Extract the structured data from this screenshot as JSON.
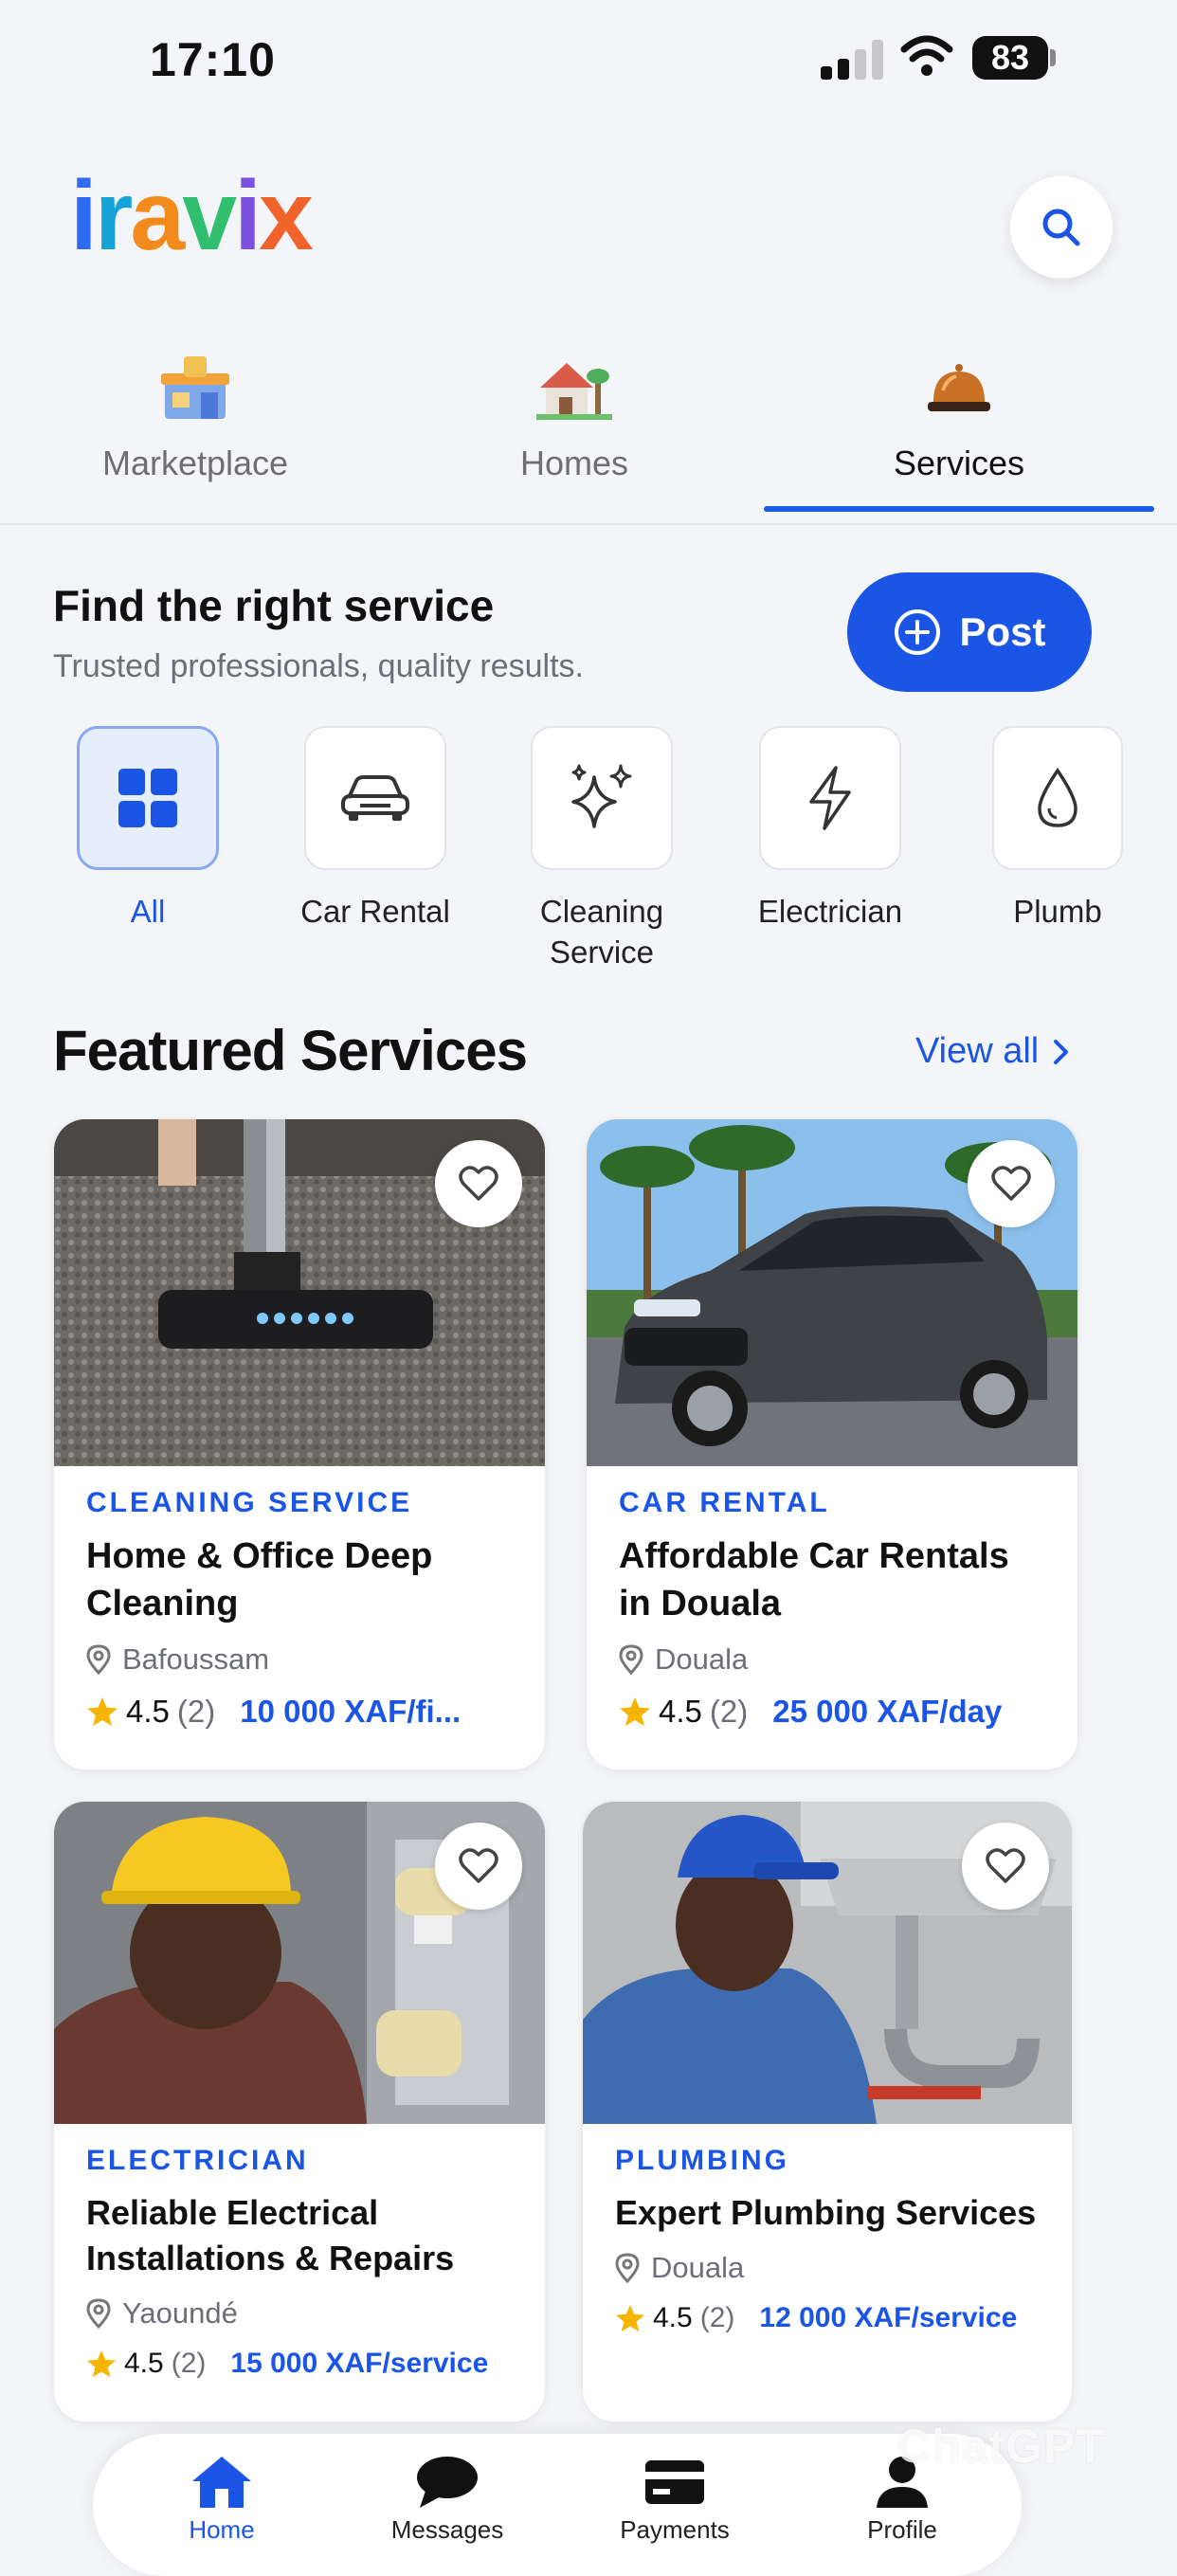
{
  "status_bar": {
    "time": "17:10",
    "battery": "83"
  },
  "header": {
    "logo_parts": [
      "i",
      "r",
      "a",
      "v",
      "i",
      "x"
    ]
  },
  "top_tabs": [
    {
      "label": "Marketplace",
      "icon": "marketplace-icon"
    },
    {
      "label": "Homes",
      "icon": "house-icon"
    },
    {
      "label": "Services",
      "icon": "service-bell-icon",
      "active": true
    }
  ],
  "services_header": {
    "title": "Find the right service",
    "subtitle": "Trusted professionals, quality results.",
    "post_label": "Post"
  },
  "categories": [
    {
      "label": "All",
      "icon": "grid-icon",
      "active": true
    },
    {
      "label": "Car Rental",
      "icon": "car-icon"
    },
    {
      "label": "Cleaning Service",
      "icon": "sparkles-icon"
    },
    {
      "label": "Electrician",
      "icon": "lightning-icon"
    },
    {
      "label": "Plumb",
      "icon": "drop-icon"
    }
  ],
  "featured": {
    "title": "Featured Services",
    "view_all": "View all",
    "cards": [
      {
        "category": "CLEANING SERVICE",
        "title": "Home & Office Deep Cleaning",
        "location": "Bafoussam",
        "rating": "4.5",
        "count": "(2)",
        "price": "10 000 XAF/fi..."
      },
      {
        "category": "CAR RENTAL",
        "title": "Affordable Car Rentals in Douala",
        "location": "Douala",
        "rating": "4.5",
        "count": "(2)",
        "price": "25 000 XAF/day"
      },
      {
        "category": "ELECTRICIAN",
        "title": "Reliable Electrical Installations & Repairs",
        "location": "Yaoundé",
        "rating": "4.5",
        "count": "(2)",
        "price": "15 000 XAF/service"
      },
      {
        "category": "PLUMBING",
        "title": "Expert Plumbing Services",
        "location": "Douala",
        "rating": "4.5",
        "count": "(2)",
        "price": "12 000 XAF/service"
      }
    ]
  },
  "bottom_nav": [
    {
      "label": "Home",
      "icon": "home-icon",
      "active": true
    },
    {
      "label": "Messages",
      "icon": "chat-bubble-icon"
    },
    {
      "label": "Payments",
      "icon": "card-icon"
    },
    {
      "label": "Profile",
      "icon": "person-icon"
    }
  ],
  "watermark": "ChatGPT",
  "colors": {
    "accent": "#1a55e6",
    "star": "#f5b400",
    "background": "#f4f5f8"
  }
}
